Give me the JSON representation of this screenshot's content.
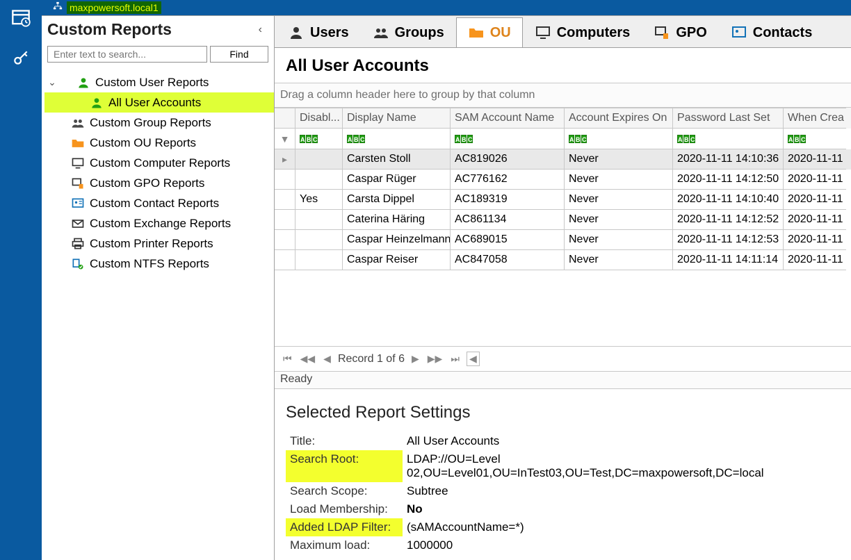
{
  "domain_label": "maxpowersoft.local1",
  "sidebar": {
    "title": "Custom Reports",
    "search_placeholder": "Enter text to search...",
    "find_label": "Find",
    "items": [
      {
        "label": "Custom User Reports",
        "children": [
          {
            "label": "All User Accounts",
            "selected": true
          }
        ]
      },
      {
        "label": "Custom Group Reports"
      },
      {
        "label": "Custom OU Reports"
      },
      {
        "label": "Custom Computer Reports"
      },
      {
        "label": "Custom GPO Reports"
      },
      {
        "label": "Custom Contact Reports"
      },
      {
        "label": "Custom Exchange Reports"
      },
      {
        "label": "Custom Printer Reports"
      },
      {
        "label": "Custom NTFS Reports"
      }
    ]
  },
  "tabs": [
    "Users",
    "Groups",
    "OU",
    "Computers",
    "GPO",
    "Contacts"
  ],
  "active_tab": "OU",
  "report_title": "All User Accounts",
  "group_hint": "Drag a column header here to group by that column",
  "columns": [
    "Disabl...",
    "Display Name",
    "SAM Account Name",
    "Account Expires On",
    "Password Last Set",
    "When Crea"
  ],
  "rows": [
    {
      "disabled": "",
      "display": "Carsten Stoll",
      "sam": "AC819026",
      "expires": "Never",
      "pwd": "2020-11-11 14:10:36",
      "created": "2020-11-11",
      "sel": true
    },
    {
      "disabled": "",
      "display": "Caspar Rüger",
      "sam": "AC776162",
      "expires": "Never",
      "pwd": "2020-11-11 14:12:50",
      "created": "2020-11-11"
    },
    {
      "disabled": "Yes",
      "display": "Carsta Dippel",
      "sam": "AC189319",
      "expires": "Never",
      "pwd": "2020-11-11 14:10:40",
      "created": "2020-11-11"
    },
    {
      "disabled": "",
      "display": "Caterina Häring",
      "sam": "AC861134",
      "expires": "Never",
      "pwd": "2020-11-11 14:12:52",
      "created": "2020-11-11"
    },
    {
      "disabled": "",
      "display": "Caspar Heinzelmann",
      "sam": "AC689015",
      "expires": "Never",
      "pwd": "2020-11-11 14:12:53",
      "created": "2020-11-11"
    },
    {
      "disabled": "",
      "display": "Caspar Reiser",
      "sam": "AC847058",
      "expires": "Never",
      "pwd": "2020-11-11 14:11:14",
      "created": "2020-11-11"
    }
  ],
  "pager_text": "Record 1 of 6",
  "status_text": "Ready",
  "settings": {
    "heading": "Selected Report Settings",
    "rows": [
      {
        "label": "Title:",
        "value": "All User Accounts",
        "hl": false
      },
      {
        "label": "Search Root:",
        "value": "LDAP://OU=Level 02,OU=Level01,OU=InTest03,OU=Test,DC=maxpowersoft,DC=local",
        "hl": true
      },
      {
        "label": "Search Scope:",
        "value": "Subtree",
        "hl": false
      },
      {
        "label": "Load Membership:",
        "value": "No",
        "hl": false,
        "bold": true
      },
      {
        "label": "Added LDAP Filter:",
        "value": "(sAMAccountName=*)",
        "hl": true
      },
      {
        "label": "Maximum load:",
        "value": "1000000",
        "hl": false
      }
    ]
  }
}
